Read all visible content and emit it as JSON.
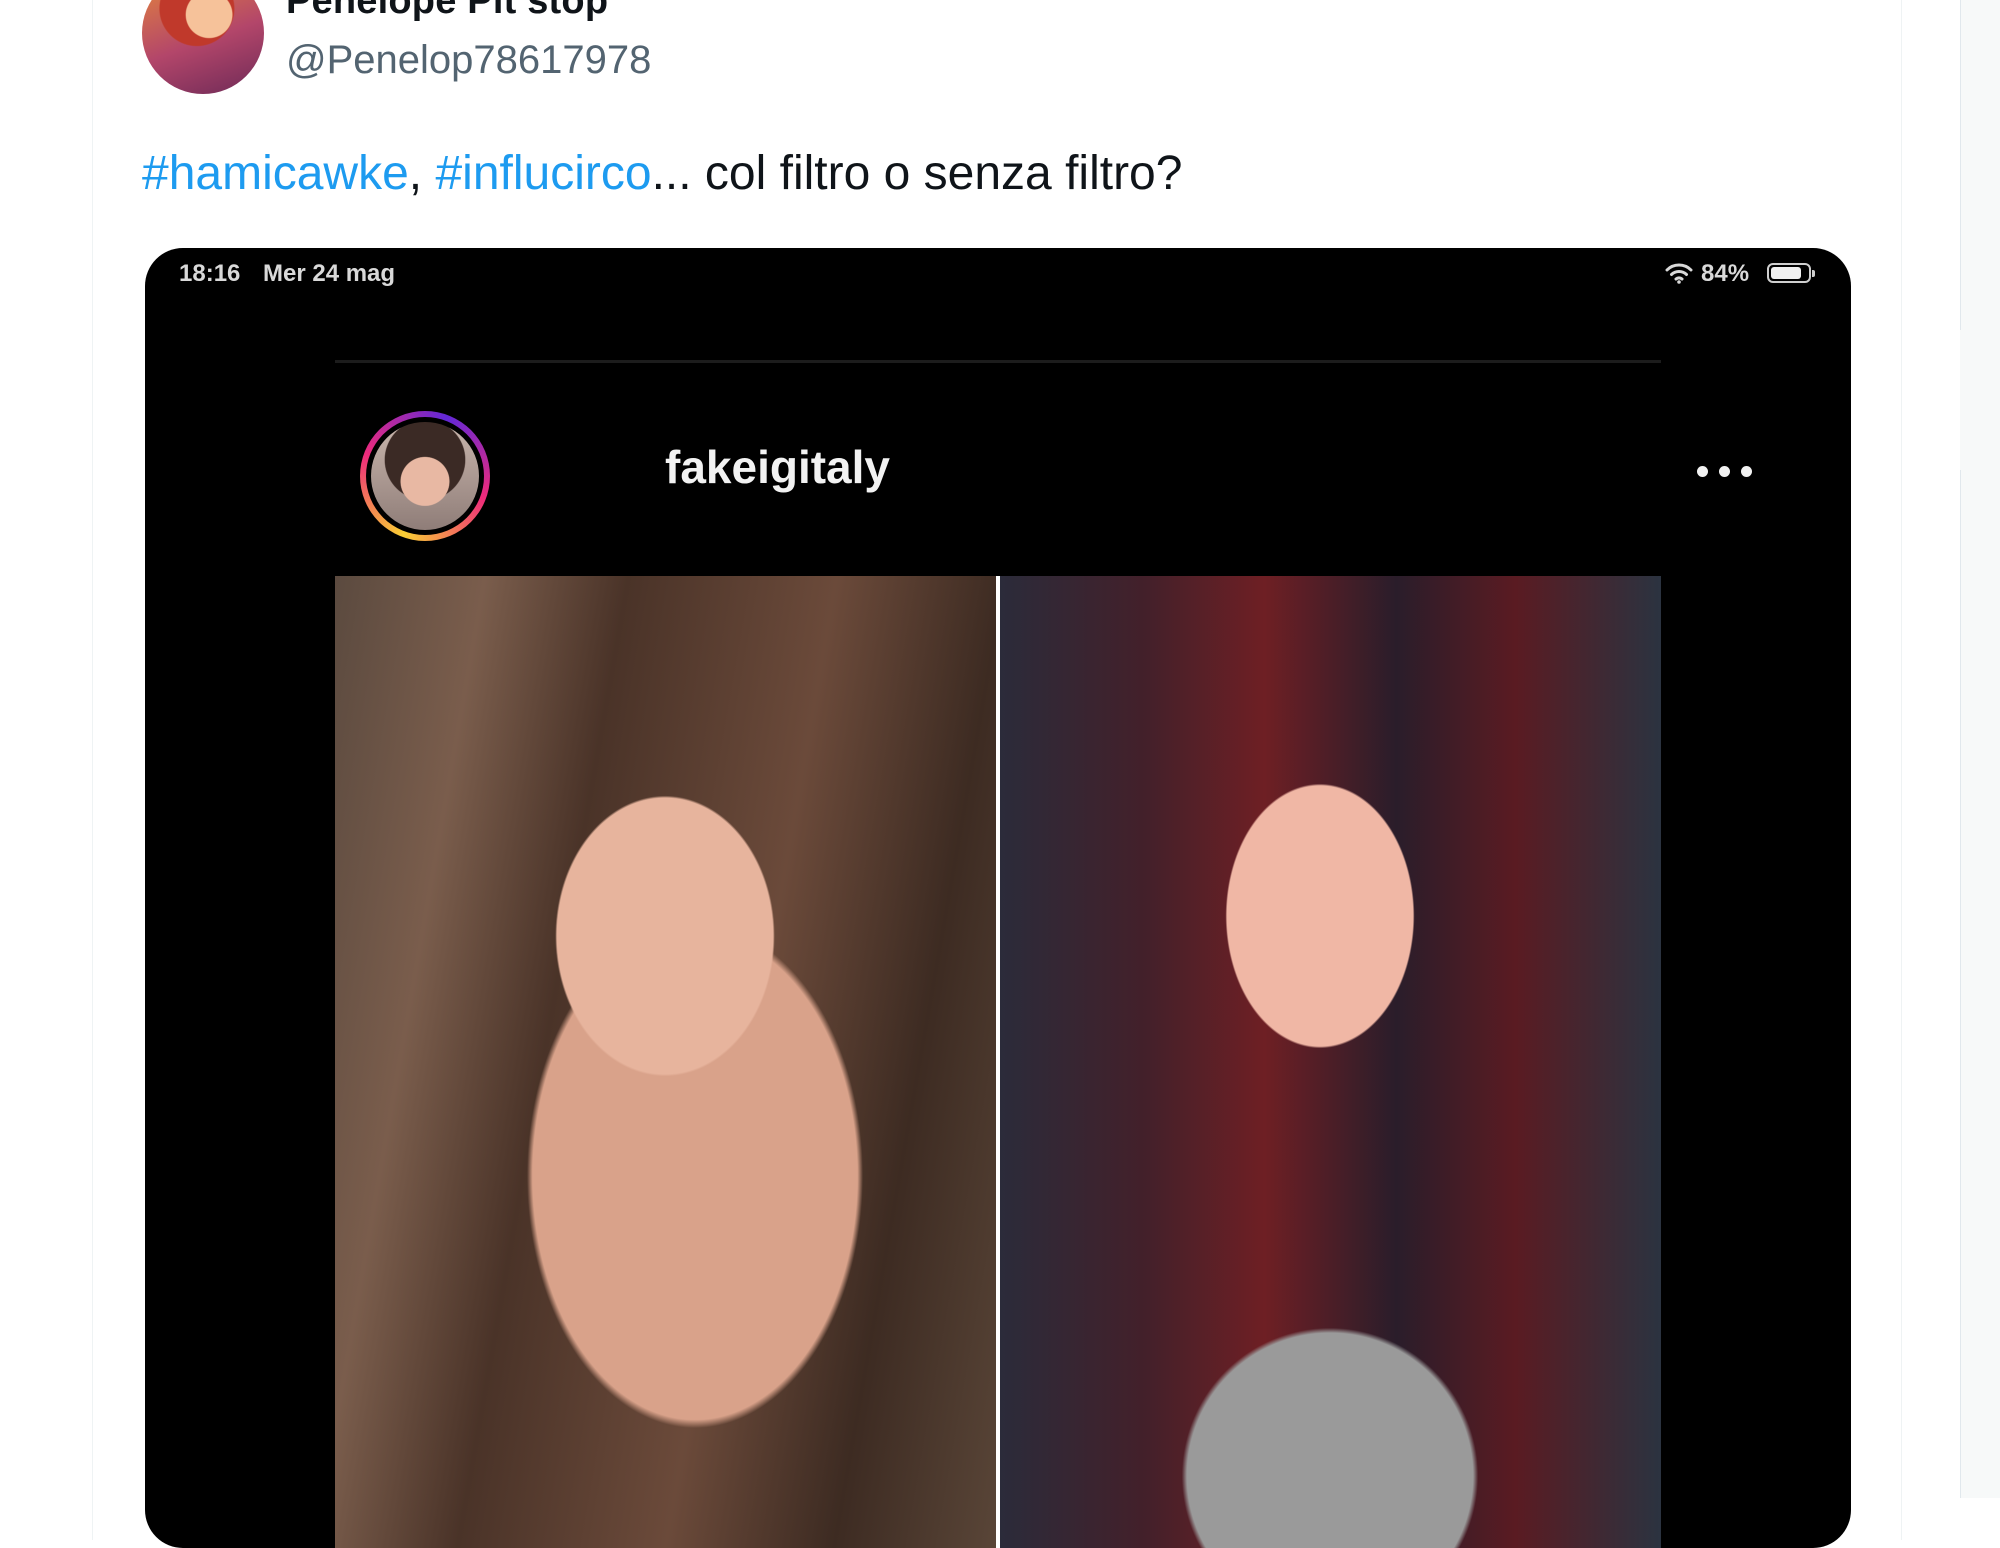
{
  "tweet": {
    "display_name": "Penelope Pit stop",
    "handle": "@Penelop78617978",
    "text": {
      "hashtag1": "#hamicawke",
      "sep": ", ",
      "hashtag2": "#influcirco",
      "rest": "... col filtro o senza filtro?"
    },
    "colors": {
      "link": "#1d9bf0",
      "text": "#0f1419",
      "secondary": "#536471"
    }
  },
  "screenshot": {
    "status_bar": {
      "time": "18:16",
      "date": "Mer 24 mag",
      "battery": "84%",
      "battery_level": 0.84
    },
    "instagram_post": {
      "username": "fakeigitaly"
    }
  },
  "icons": [
    "more-horizontal-icon",
    "wifi-icon",
    "battery-icon",
    "ig-more-icon"
  ]
}
